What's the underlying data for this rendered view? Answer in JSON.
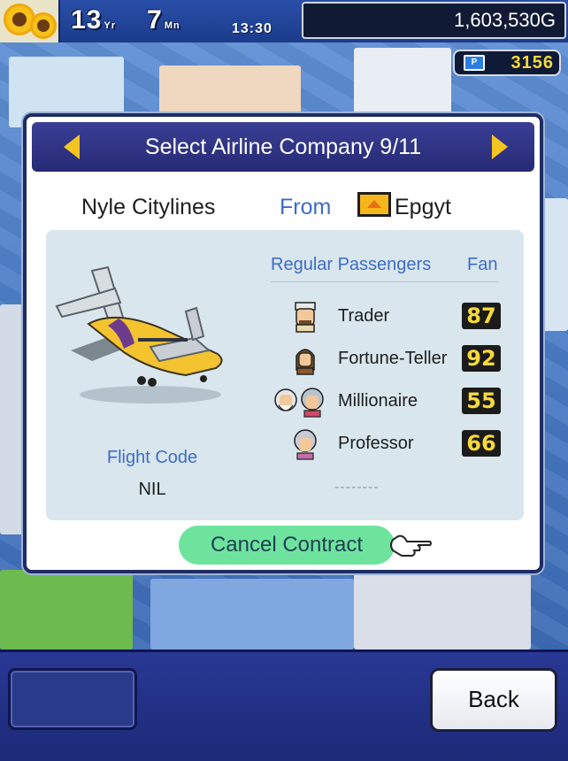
{
  "hud": {
    "year": "13",
    "year_unit": "Yr",
    "month": "7",
    "month_unit": "Mn",
    "time": "13:30",
    "money": "1,603,530G",
    "points": "3156",
    "points_icon": "P"
  },
  "dialog": {
    "title": "Select Airline Company 9/11",
    "airline_name": "Nyle Citylines",
    "from_label": "From",
    "country": "Epgyt",
    "regular_passengers_label": "Regular Passengers",
    "fan_label": "Fan",
    "flight_code_label": "Flight Code",
    "flight_code_value": "NIL",
    "passengers": [
      {
        "name": "Trader",
        "fan": "87"
      },
      {
        "name": "Fortune-Teller",
        "fan": "92"
      },
      {
        "name": "Millionaire",
        "fan": "55"
      },
      {
        "name": "Professor",
        "fan": "66"
      }
    ],
    "empty_slot": "--------",
    "cancel_label": "Cancel Contract"
  },
  "footer": {
    "back_label": "Back"
  },
  "colors": {
    "accent_blue": "#3d6cc7",
    "header_navy": "#262a74",
    "cancel_green": "#6ee39e",
    "fan_yellow": "#f7d93b"
  }
}
